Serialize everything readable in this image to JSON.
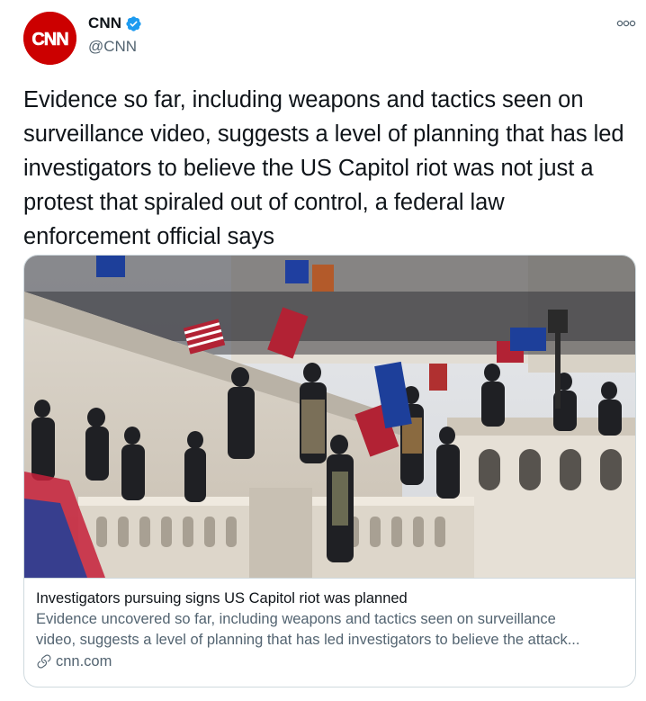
{
  "author": {
    "display_name": "CNN",
    "handle": "@CNN",
    "avatar_logo_text": "CNN",
    "verified": true
  },
  "tweet": {
    "text": "Evidence so far, including weapons and tactics seen on surveillance video, suggests a level of planning that has led investigators to believe the US Capitol riot was not just a protest that spiraled out of control, a federal law enforcement official says"
  },
  "card": {
    "title": "Investigators pursuing signs US Capitol riot was planned",
    "description_line1": "Evidence uncovered so far, including weapons and tactics seen on surveillance",
    "description_line2": "video, suggests a level of planning that has led investigators to believe the attack...",
    "domain": "cnn.com",
    "image_caption": "Capitol steps crowd with flags"
  },
  "icons": {
    "more": "more-options-icon",
    "verified": "verified-badge-icon",
    "link": "link-icon"
  },
  "colors": {
    "brand_red": "#cc0000",
    "verified_blue": "#1d9bf0",
    "text_primary": "#0f1419",
    "text_secondary": "#536471",
    "border": "#cfd9de"
  }
}
